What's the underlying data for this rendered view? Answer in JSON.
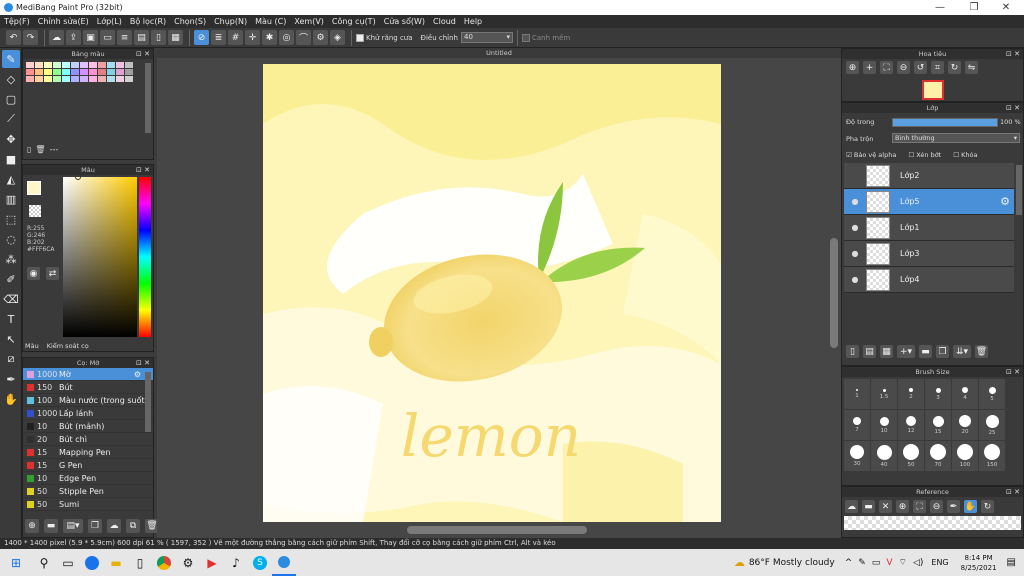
{
  "window": {
    "title": "MediBang Paint Pro (32bit)",
    "minimize": "—",
    "maximize": "❐",
    "close": "✕"
  },
  "menu": [
    "Tệp(F)",
    "Chỉnh sửa(E)",
    "Lớp(L)",
    "Bộ lọc(R)",
    "Chọn(S)",
    "Chụp(N)",
    "Màu (C)",
    "Xem(V)",
    "Công cụ(T)",
    "Cửa sổ(W)",
    "Cloud",
    "Help"
  ],
  "toolbar": {
    "antialias_label": "Khử răng cưa",
    "adjust_label": "Điều chỉnh",
    "adjust_value": "40",
    "smooth_label": "Canh mềm"
  },
  "palette_panel": {
    "title": "Bảng màu",
    "footer": "---"
  },
  "color_panel": {
    "title": "Màu",
    "r": "R:255",
    "g": "G:246",
    "b": "B:202",
    "hex": "#FFF6CA",
    "tab_color": "Màu",
    "tab_control": "Kiểm soát cọ",
    "current_color": "#fff6ca"
  },
  "brush_panel": {
    "title": "Cọ: Mờ",
    "items": [
      {
        "size": "1000",
        "name": "Mờ",
        "color": "#e0a0e0"
      },
      {
        "size": "150",
        "name": "Bút",
        "color": "#e03030"
      },
      {
        "size": "100",
        "name": "Màu nước (trong suốt)",
        "color": "#60c0e0"
      },
      {
        "size": "1000",
        "name": "Lấp lánh",
        "color": "#3050d0"
      },
      {
        "size": "10",
        "name": "Bút (mảnh)",
        "color": "#202020"
      },
      {
        "size": "20",
        "name": "Bút chì",
        "color": "#303030"
      },
      {
        "size": "15",
        "name": "Mapping Pen",
        "color": "#e03030"
      },
      {
        "size": "15",
        "name": "G Pen",
        "color": "#e03030"
      },
      {
        "size": "10",
        "name": "Edge Pen",
        "color": "#30a030"
      },
      {
        "size": "50",
        "name": "Stipple Pen",
        "color": "#e0d020"
      },
      {
        "size": "50",
        "name": "Sumi",
        "color": "#e0d020"
      }
    ]
  },
  "canvas": {
    "tab": "Untitled",
    "text": "lemon"
  },
  "navigator": {
    "title": "Hoa tiêu"
  },
  "layer_panel": {
    "title": "Lớp",
    "opacity_label": "Độ trong",
    "opacity_value": "100 %",
    "opacity_fraction": 1.0,
    "blend_label": "Pha trộn",
    "blend_value": "Bình thường",
    "alpha_label": "Bảo vệ alpha",
    "clip_label": "Xén bớt",
    "lock_label": "Khóa",
    "layers": [
      {
        "name": "Lớp2",
        "visible": false,
        "selected": false
      },
      {
        "name": "Lớp5",
        "visible": true,
        "selected": true
      },
      {
        "name": "Lớp1",
        "visible": true,
        "selected": false
      },
      {
        "name": "Lớp3",
        "visible": true,
        "selected": false
      },
      {
        "name": "Lớp4",
        "visible": true,
        "selected": false
      }
    ]
  },
  "brush_size_panel": {
    "title": "Brush Size",
    "sizes": [
      "1",
      "1.5",
      "2",
      "3",
      "4",
      "5",
      "7",
      "10",
      "12",
      "15",
      "20",
      "25",
      "30",
      "40",
      "50",
      "70",
      "100",
      "150"
    ]
  },
  "reference_panel": {
    "title": "Reference"
  },
  "status": {
    "text": "1400 * 1400 pixel   (5.9 * 5.9cm)   600 dpi   61 %   ( 1597, 352 )   Vẽ một đường thẳng bằng cách giữ phím Shift, Thay đổi cỡ cọ bằng cách giữ phím Ctrl, Alt và kéo"
  },
  "taskbar": {
    "weather": "86°F  Mostly cloudy",
    "lang": "ENG",
    "time": "8:14 PM",
    "date": "8/25/2021"
  }
}
